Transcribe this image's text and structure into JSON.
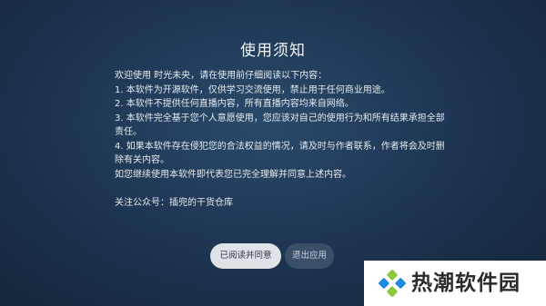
{
  "dialog": {
    "title": "使用须知",
    "intro": "欢迎使用 时光未央，请在使用前仔细阅读以下内容：",
    "items": [
      "1. 本软件为开源软件，仅供学习交流使用，禁止用于任何商业用途。",
      "2. 本软件不提供任何直播内容，所有直播内容均来自网络。",
      "3. 本软件完全基于您个人意愿使用，您应该对自己的使用行为和所有结果承担全部责任。",
      "4. 如果本软件存在侵犯您的合法权益的情况，请及时与作者联系，作者将会及时删除有关内容。"
    ],
    "closing": "如您继续使用本软件即代表您已完全理解并同意上述内容。",
    "follow": "关注公众号：插兜的干货仓库",
    "agree_label": "已阅读并同意",
    "exit_label": "退出应用"
  },
  "watermark": {
    "text": "热潮软件园",
    "logo_icon": "diamond-leaf-logo"
  },
  "colors": {
    "background_center": "#2a4a6a",
    "background_edge": "#132539",
    "agree_button": "#dfe3e8",
    "exit_button": "#3a5069",
    "logo_green": "#8cc63f",
    "logo_blue": "#1e88e5"
  }
}
